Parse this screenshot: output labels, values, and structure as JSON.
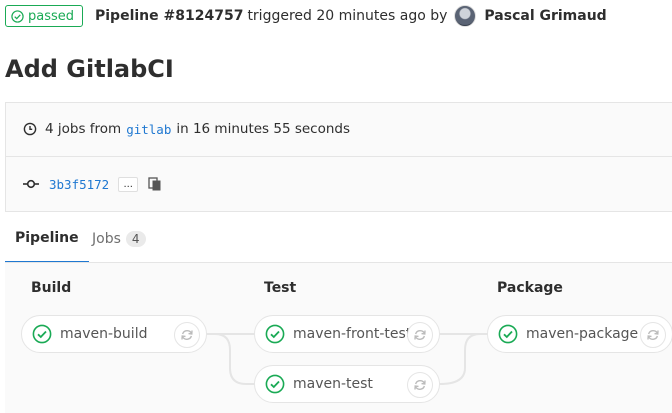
{
  "header": {
    "status": "passed",
    "pipeline_label": "Pipeline #8124757",
    "triggered_text": "triggered 20 minutes ago by",
    "user_name": "Pascal Grimaud"
  },
  "title": "Add GitlabCI",
  "info": {
    "jobs_prefix": "4 jobs from",
    "ref": "gitlab",
    "duration_text": "in 16 minutes 55 seconds",
    "commit_sha": "3b3f5172",
    "ellipsis": "..."
  },
  "tabs": [
    {
      "label": "Pipeline",
      "active": true
    },
    {
      "label": "Jobs",
      "count": "4",
      "active": false
    }
  ],
  "stages": [
    {
      "name": "Build",
      "jobs": [
        {
          "name": "maven-build",
          "status": "success"
        }
      ]
    },
    {
      "name": "Test",
      "jobs": [
        {
          "name": "maven-front-test",
          "status": "success"
        },
        {
          "name": "maven-test",
          "status": "success"
        }
      ]
    },
    {
      "name": "Package",
      "jobs": [
        {
          "name": "maven-package",
          "status": "success"
        }
      ]
    }
  ],
  "colors": {
    "success": "#1aaa55",
    "link": "#1f78d1",
    "connector": "#e5e5e5"
  },
  "icons": [
    "check-circle-icon",
    "clock-icon",
    "commit-icon",
    "copy-icon",
    "retry-icon"
  ]
}
